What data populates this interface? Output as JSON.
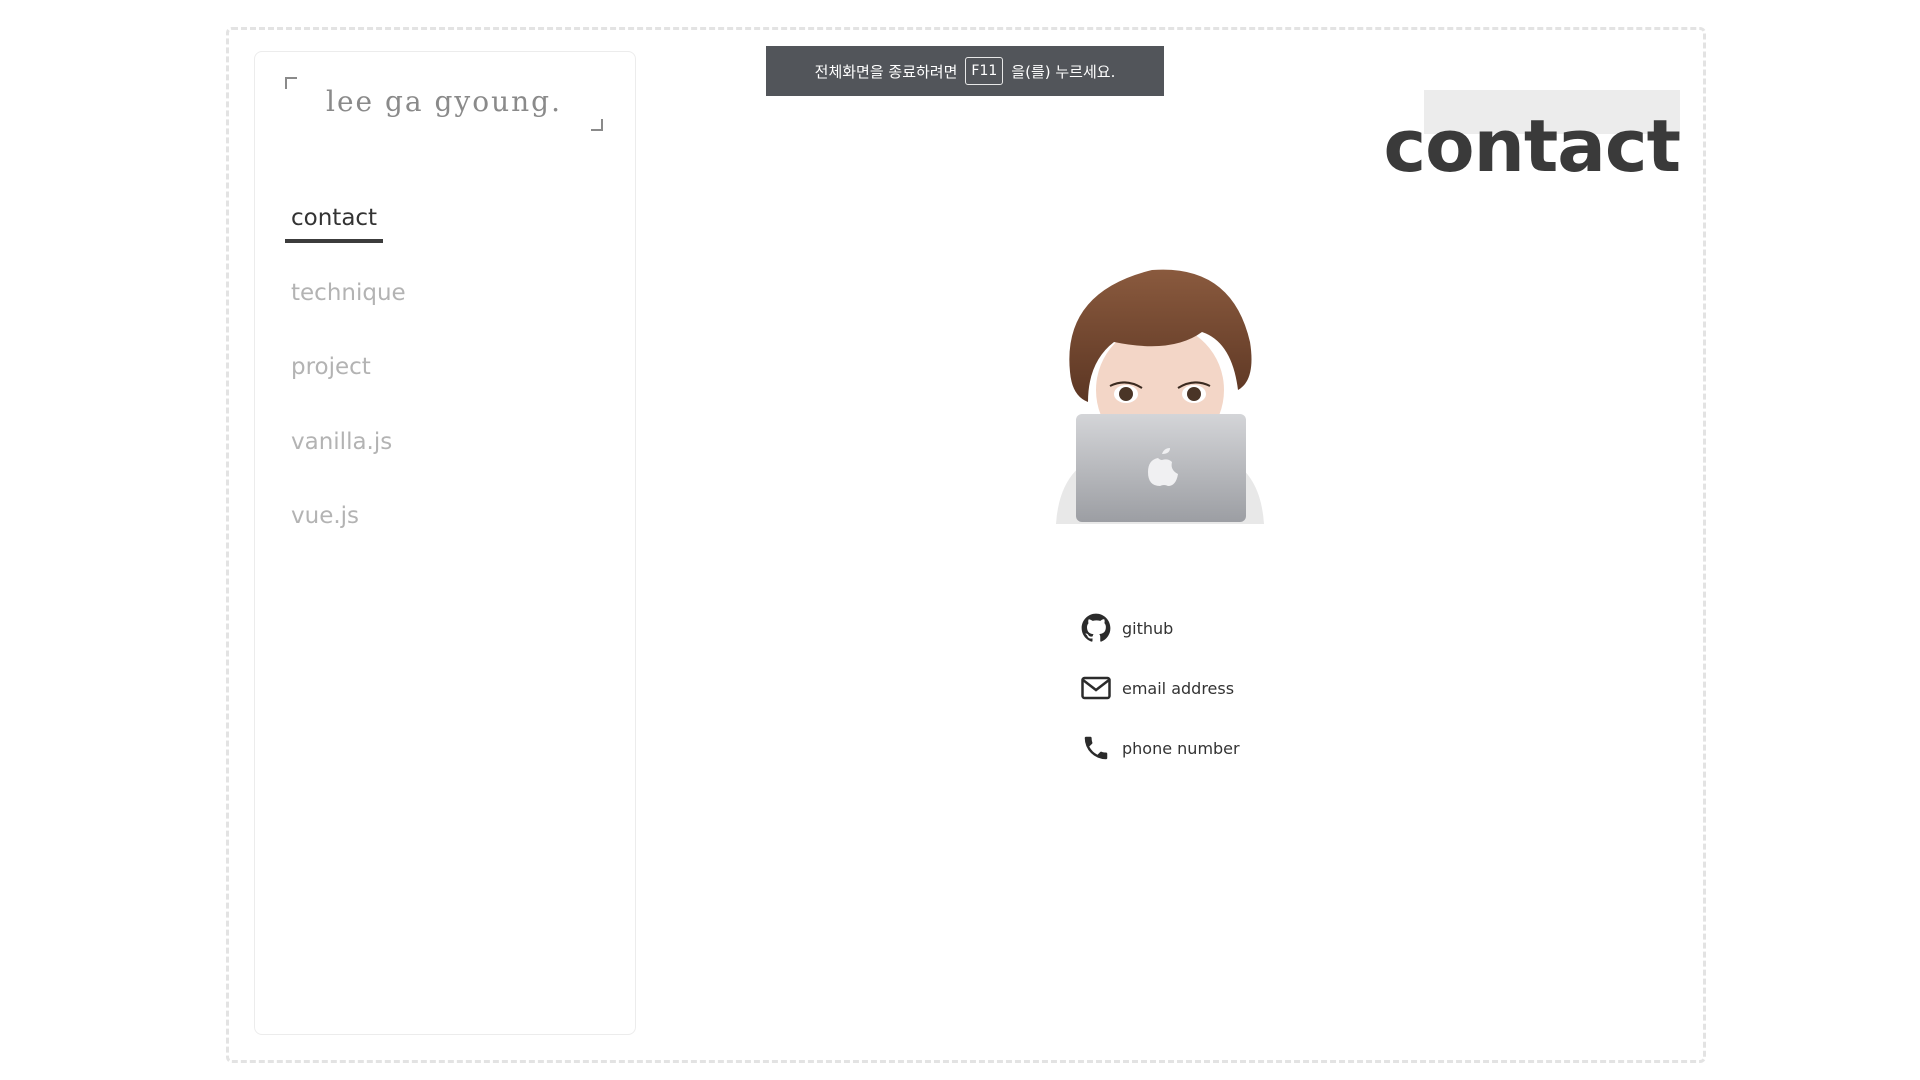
{
  "sidebar": {
    "logo": "lee ga gyoung.",
    "nav": [
      {
        "label": "contact",
        "active": true
      },
      {
        "label": "technique",
        "active": false
      },
      {
        "label": "project",
        "active": false
      },
      {
        "label": "vanilla.js",
        "active": false
      },
      {
        "label": "vue.js",
        "active": false
      }
    ]
  },
  "toast": {
    "text_before": "전체화면을 종료하려면",
    "key": "F11",
    "text_after": "을(를) 누르세요."
  },
  "main": {
    "title": "contact",
    "avatar_icon": "memoji-laptop-avatar",
    "contacts": [
      {
        "label": "github",
        "icon": "github-icon"
      },
      {
        "label": "email address",
        "icon": "envelope-icon"
      },
      {
        "label": "phone number",
        "icon": "phone-icon"
      }
    ]
  },
  "colors": {
    "text_dark": "#333333",
    "nav_inactive": "#b3b3b3",
    "toast_bg": "#52555a",
    "title_highlight": "#ececec"
  }
}
